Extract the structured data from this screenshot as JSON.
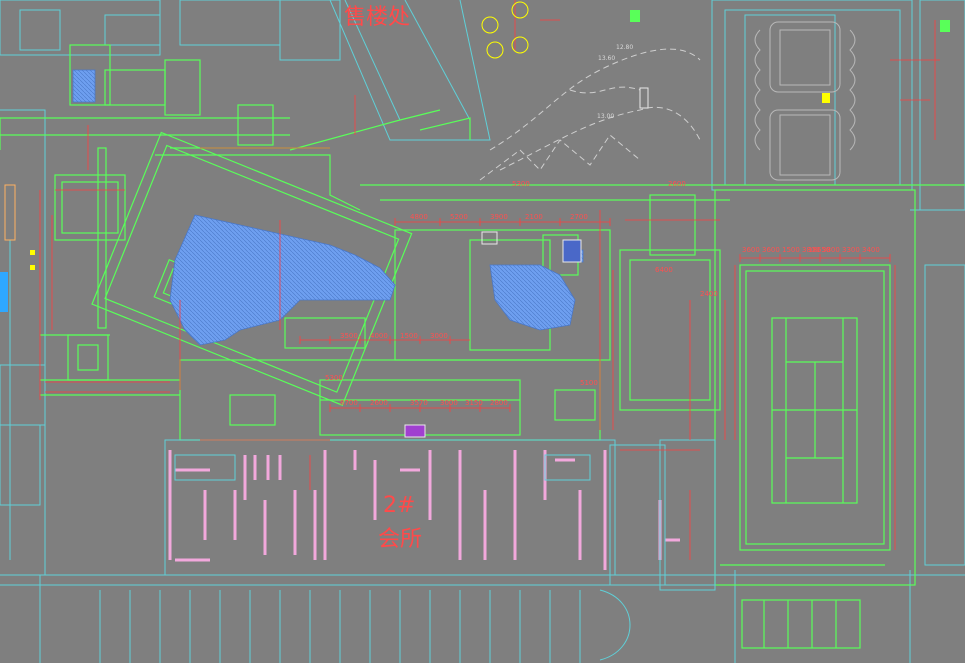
{
  "drawing": {
    "labels": {
      "top_building": "售楼处",
      "clubhouse_no": "2#",
      "clubhouse": "会所"
    },
    "dimensions": [
      "18650",
      "3600",
      "3600",
      "1500",
      "3800",
      "3800",
      "3300",
      "3400",
      "6400",
      "5300",
      "5100",
      "8700",
      "2600",
      "3570",
      "3000",
      "3150",
      "2800",
      "4800",
      "5200",
      "3900",
      "2100",
      "2700",
      "3500",
      "4000",
      "1500",
      "3000",
      "12.80",
      "13.60",
      "13.00",
      "5300",
      "2600",
      "2400"
    ],
    "colors": {
      "background": "#7f7f7f",
      "wall_green": "#59ff59",
      "dimension_red": "#ff3f3f",
      "outline_cyan": "#5fd0d8",
      "pool_blue": "#6e9ff0",
      "wall_pink": "#f2a8dc",
      "label_red": "#ff4a4a"
    }
  }
}
